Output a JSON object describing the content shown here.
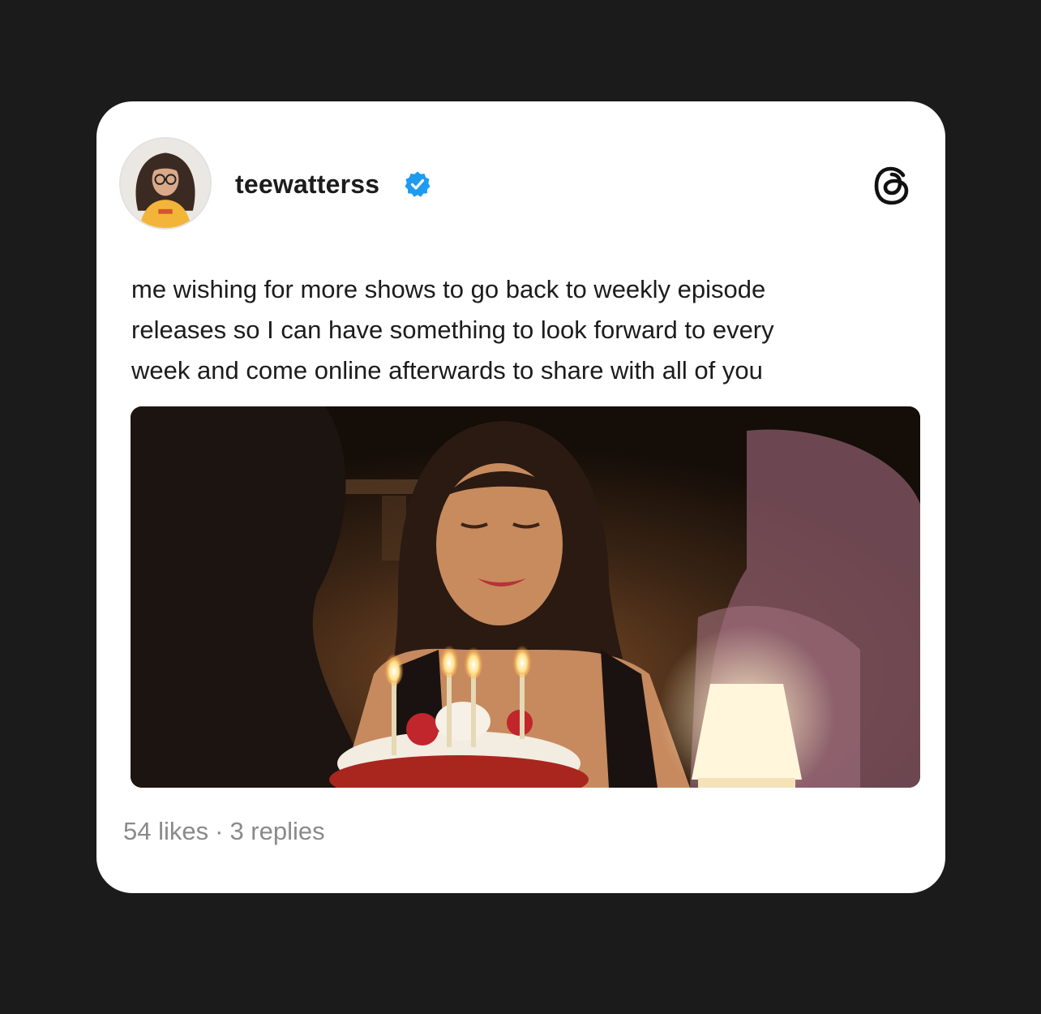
{
  "post": {
    "username": "teewatterss",
    "verified": true,
    "text": "me wishing for more shows to go back to weekly episode\nreleases so I can have something to look forward to every\nweek and come online afterwards to share with all of you",
    "stats": {
      "likes": "54 likes",
      "separator": "·",
      "replies": "3 replies"
    }
  },
  "icons": {
    "verified": "verified-badge-icon",
    "app_logo": "threads-logo-icon"
  },
  "colors": {
    "background": "#1b1b1b",
    "card": "#ffffff",
    "text": "#1c1c1c",
    "muted": "#8a8a8a",
    "verified_blue": "#1d9bf0"
  }
}
